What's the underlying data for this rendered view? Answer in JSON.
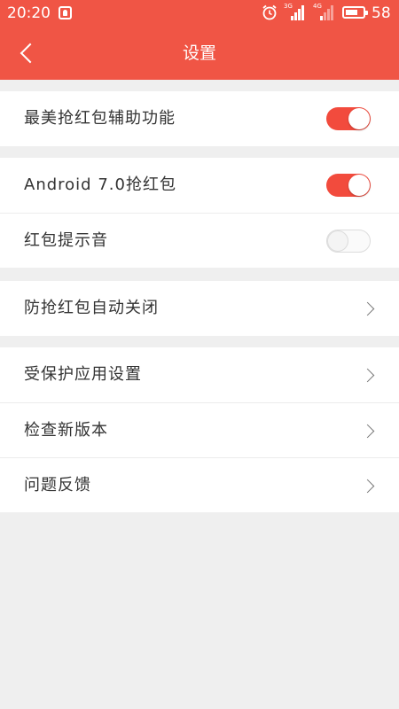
{
  "status_bar": {
    "time": "20:20",
    "battery_percent": "58",
    "signal_1_tag": "3G",
    "signal_2_tag": "4G"
  },
  "header": {
    "title": "设置"
  },
  "settings": {
    "group1": [
      {
        "label": "最美抢红包辅助功能",
        "control": "toggle",
        "on": true
      }
    ],
    "group2": [
      {
        "label": "Android 7.0抢红包",
        "control": "toggle",
        "on": true
      },
      {
        "label": "红包提示音",
        "control": "toggle",
        "on": false
      }
    ],
    "group3": [
      {
        "label": "防抢红包自动关闭",
        "control": "chevron"
      }
    ],
    "group4": [
      {
        "label": "受保护应用设置",
        "control": "chevron"
      },
      {
        "label": "检查新版本",
        "control": "chevron"
      },
      {
        "label": "问题反馈",
        "control": "chevron"
      }
    ]
  },
  "colors": {
    "primary": "#f05545",
    "toggle_on": "#f24b3d",
    "background": "#efefef"
  }
}
